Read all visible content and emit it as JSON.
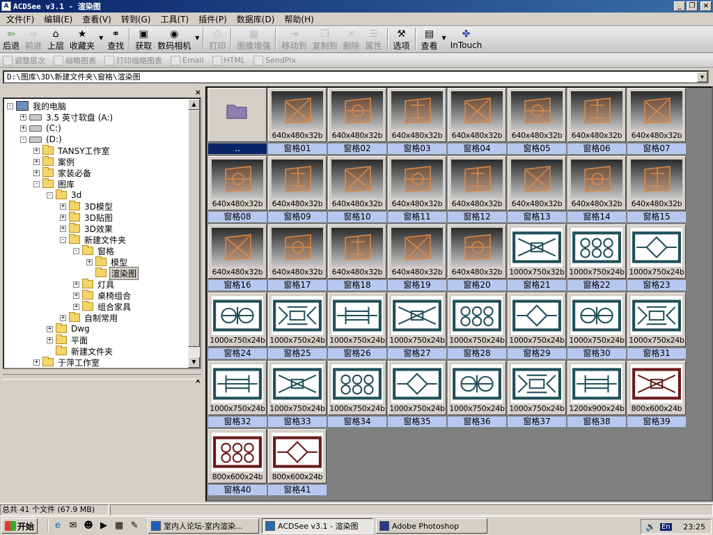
{
  "window": {
    "title": "ACDSee v3.1 - 渲染图",
    "app_icon": "acdsee-icon"
  },
  "menu": [
    "文件(F)",
    "编辑(E)",
    "查看(V)",
    "转到(G)",
    "工具(T)",
    "插件(P)",
    "数据库(D)",
    "帮助(H)"
  ],
  "toolbar": [
    {
      "label": "后退",
      "icon": "back-arrow-icon",
      "enabled": true
    },
    {
      "label": "前进",
      "icon": "forward-icon",
      "enabled": false
    },
    {
      "label": "上层",
      "icon": "up-folder-icon",
      "enabled": true
    },
    {
      "label": "收藏夹",
      "icon": "favorites-icon",
      "enabled": true,
      "dropdown": true
    },
    {
      "label": "查找",
      "icon": "binoculars-icon",
      "enabled": true
    },
    {
      "label": "获取",
      "icon": "acquire-icon",
      "enabled": true
    },
    {
      "label": "数码相机",
      "icon": "camera-icon",
      "enabled": true,
      "dropdown": true
    },
    {
      "label": "打印",
      "icon": "printer-icon",
      "enabled": false
    },
    {
      "label": "图像增强",
      "icon": "enhance-icon",
      "enabled": false
    },
    {
      "label": "移动到",
      "icon": "move-icon",
      "enabled": false
    },
    {
      "label": "复制到",
      "icon": "copy-icon",
      "enabled": false
    },
    {
      "label": "删除",
      "icon": "delete-icon",
      "enabled": false
    },
    {
      "label": "属性",
      "icon": "properties-icon",
      "enabled": false
    },
    {
      "label": "选项",
      "icon": "options-icon",
      "enabled": true
    },
    {
      "label": "查看",
      "icon": "view-icon",
      "enabled": true,
      "dropdown": true
    },
    {
      "label": "InTouch",
      "icon": "intouch-icon",
      "enabled": true
    }
  ],
  "toolbar2": [
    "调整层次",
    "缩略图表",
    "打印缩略图表",
    "Email",
    "HTML",
    "SendPix"
  ],
  "path": "D:\\图库\\3D\\新建文件夹\\窗格\\渲染图",
  "tree": [
    {
      "label": "我的电脑",
      "indent": 0,
      "icon": "pc",
      "exp": "-"
    },
    {
      "label": "3.5 英寸软盘 (A:)",
      "indent": 1,
      "icon": "drive",
      "exp": "+"
    },
    {
      "label": "(C:)",
      "indent": 1,
      "icon": "drive",
      "exp": "+"
    },
    {
      "label": "(D:)",
      "indent": 1,
      "icon": "drive",
      "exp": "-"
    },
    {
      "label": "TANSY工作室",
      "indent": 2,
      "icon": "folder",
      "exp": "+"
    },
    {
      "label": "案例",
      "indent": 2,
      "icon": "folder",
      "exp": "+"
    },
    {
      "label": "家装必备",
      "indent": 2,
      "icon": "folder",
      "exp": "+"
    },
    {
      "label": "图库",
      "indent": 2,
      "icon": "folder",
      "exp": "-"
    },
    {
      "label": "3d",
      "indent": 3,
      "icon": "folder",
      "exp": "-"
    },
    {
      "label": "3D模型",
      "indent": 4,
      "icon": "folder",
      "exp": "+"
    },
    {
      "label": "3D贴图",
      "indent": 4,
      "icon": "folder",
      "exp": "+"
    },
    {
      "label": "3D效果",
      "indent": 4,
      "icon": "folder",
      "exp": "+"
    },
    {
      "label": "新建文件夹",
      "indent": 4,
      "icon": "folder",
      "exp": "-"
    },
    {
      "label": "窗格",
      "indent": 5,
      "icon": "folder",
      "exp": "-"
    },
    {
      "label": "模型",
      "indent": 6,
      "icon": "folder",
      "exp": "+"
    },
    {
      "label": "渲染图",
      "indent": 6,
      "icon": "folder-open",
      "exp": "",
      "selected": true
    },
    {
      "label": "灯具",
      "indent": 5,
      "icon": "folder",
      "exp": "+"
    },
    {
      "label": "桌椅组合",
      "indent": 5,
      "icon": "folder",
      "exp": "+"
    },
    {
      "label": "组合家具",
      "indent": 5,
      "icon": "folder",
      "exp": "+"
    },
    {
      "label": "自制常用",
      "indent": 4,
      "icon": "folder",
      "exp": "+"
    },
    {
      "label": "Dwg",
      "indent": 3,
      "icon": "folder",
      "exp": "+"
    },
    {
      "label": "平面",
      "indent": 3,
      "icon": "folder",
      "exp": "+"
    },
    {
      "label": "新建文件夹",
      "indent": 3,
      "icon": "folder",
      "exp": ""
    },
    {
      "label": "于萍工作室",
      "indent": 2,
      "icon": "folder",
      "exp": "+"
    }
  ],
  "thumbnails": [
    {
      "name": "..",
      "dim": "",
      "type": "parent-folder",
      "selected": true
    },
    {
      "name": "窗格01",
      "dim": "640x480x32b",
      "type": "render"
    },
    {
      "name": "窗格02",
      "dim": "640x480x32b",
      "type": "render"
    },
    {
      "name": "窗格03",
      "dim": "640x480x32b",
      "type": "render"
    },
    {
      "name": "窗格04",
      "dim": "640x480x32b",
      "type": "render"
    },
    {
      "name": "窗格05",
      "dim": "640x480x32b",
      "type": "render"
    },
    {
      "name": "窗格06",
      "dim": "640x480x32b",
      "type": "render"
    },
    {
      "name": "窗格07",
      "dim": "640x480x32b",
      "type": "render"
    },
    {
      "name": "窗格08",
      "dim": "640x480x32b",
      "type": "render"
    },
    {
      "name": "窗格09",
      "dim": "640x480x32b",
      "type": "render"
    },
    {
      "name": "窗格10",
      "dim": "640x480x32b",
      "type": "render"
    },
    {
      "name": "窗格11",
      "dim": "640x480x32b",
      "type": "render"
    },
    {
      "name": "窗格12",
      "dim": "640x480x32b",
      "type": "render"
    },
    {
      "name": "窗格13",
      "dim": "640x480x32b",
      "type": "render"
    },
    {
      "name": "窗格14",
      "dim": "640x480x32b",
      "type": "render"
    },
    {
      "name": "窗格15",
      "dim": "640x480x32b",
      "type": "render"
    },
    {
      "name": "窗格16",
      "dim": "640x480x32b",
      "type": "render"
    },
    {
      "name": "窗格17",
      "dim": "640x480x32b",
      "type": "render"
    },
    {
      "name": "窗格18",
      "dim": "640x480x32b",
      "type": "render"
    },
    {
      "name": "窗格19",
      "dim": "640x480x32b",
      "type": "render"
    },
    {
      "name": "窗格20",
      "dim": "640x480x32b",
      "type": "render"
    },
    {
      "name": "窗格21",
      "dim": "1000x750x32b",
      "type": "lineart",
      "color": "#1f4f5a"
    },
    {
      "name": "窗格22",
      "dim": "1000x750x24b",
      "type": "lineart",
      "color": "#1f4f5a"
    },
    {
      "name": "窗格23",
      "dim": "1000x750x24b",
      "type": "lineart",
      "color": "#1f4f5a"
    },
    {
      "name": "窗格24",
      "dim": "1000x750x24b",
      "type": "lineart",
      "color": "#1f4f5a"
    },
    {
      "name": "窗格25",
      "dim": "1000x750x24b",
      "type": "lineart",
      "color": "#1f4f5a"
    },
    {
      "name": "窗格26",
      "dim": "1000x750x24b",
      "type": "lineart",
      "color": "#1f4f5a"
    },
    {
      "name": "窗格27",
      "dim": "1000x750x24b",
      "type": "lineart",
      "color": "#1f4f5a"
    },
    {
      "name": "窗格28",
      "dim": "1000x750x24b",
      "type": "lineart",
      "color": "#1f4f5a"
    },
    {
      "name": "窗格29",
      "dim": "1000x750x24b",
      "type": "lineart",
      "color": "#1f4f5a"
    },
    {
      "name": "窗格30",
      "dim": "1000x750x24b",
      "type": "lineart",
      "color": "#1f4f5a"
    },
    {
      "name": "窗格31",
      "dim": "1000x750x24b",
      "type": "lineart",
      "color": "#1f4f5a"
    },
    {
      "name": "窗格32",
      "dim": "1000x750x24b",
      "type": "lineart",
      "color": "#1f4f5a"
    },
    {
      "name": "窗格33",
      "dim": "1000x750x24b",
      "type": "lineart",
      "color": "#1f4f5a"
    },
    {
      "name": "窗格34",
      "dim": "1000x750x24b",
      "type": "lineart",
      "color": "#1f4f5a"
    },
    {
      "name": "窗格35",
      "dim": "1000x750x24b",
      "type": "lineart",
      "color": "#1f4f5a"
    },
    {
      "name": "窗格36",
      "dim": "1000x750x24b",
      "type": "lineart",
      "color": "#1f4f5a"
    },
    {
      "name": "窗格37",
      "dim": "1000x750x24b",
      "type": "lineart",
      "color": "#1f4f5a"
    },
    {
      "name": "窗格38",
      "dim": "1200x900x24b",
      "type": "lineart",
      "color": "#1f4f5a"
    },
    {
      "name": "窗格39",
      "dim": "800x600x24b",
      "type": "lineart",
      "color": "#6a1a1a"
    },
    {
      "name": "窗格40",
      "dim": "800x600x24b",
      "type": "lineart",
      "color": "#6a1a1a"
    },
    {
      "name": "窗格41",
      "dim": "800x600x24b",
      "type": "lineart",
      "color": "#6a1a1a"
    }
  ],
  "status": {
    "summary": "总共 41 个文件 (67.9 MB)"
  },
  "taskbar": {
    "start": "开始",
    "quicklaunch": [
      "ie-icon",
      "outlook-icon",
      "qq-icon",
      "media-icon",
      "desktop-icon",
      "pen-icon"
    ],
    "tasks": [
      {
        "label": "室内人论坛-室内渲染...",
        "icon": "ie-icon",
        "active": false
      },
      {
        "label": "ACDSee v3.1 - 渲染图",
        "icon": "acdsee-icon",
        "active": true
      },
      {
        "label": "Adobe Photoshop",
        "icon": "photoshop-icon",
        "active": false
      }
    ],
    "tray_lang": "En",
    "clock": "23:25"
  },
  "colors": {
    "title_start": "#0a246a",
    "title_end": "#3a6ea5",
    "label_bg": "#b7c8f0",
    "selected": "#0a246a"
  }
}
